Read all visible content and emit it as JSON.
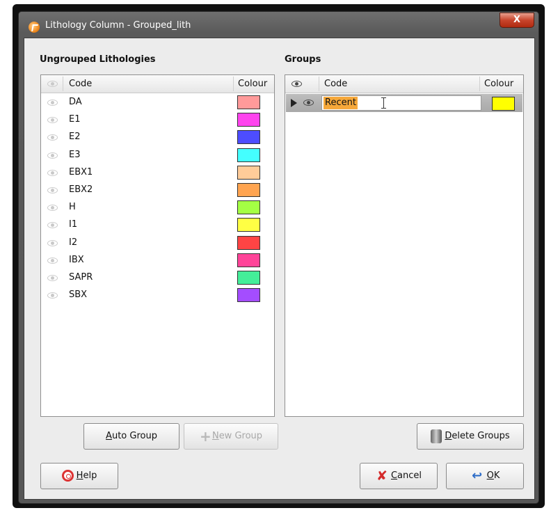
{
  "window": {
    "title": "Lithology Column - Grouped_lith",
    "close_glyph": "X"
  },
  "ungrouped": {
    "label": "Ungrouped Lithologies",
    "columns": {
      "code": "Code",
      "colour": "Colour"
    },
    "rows": [
      {
        "code": "DA",
        "colour": "#FF9A9A"
      },
      {
        "code": "E1",
        "colour": "#FF44EE"
      },
      {
        "code": "E2",
        "colour": "#4D4DFF"
      },
      {
        "code": "E3",
        "colour": "#44FFFF"
      },
      {
        "code": "EBX1",
        "colour": "#FFCC99"
      },
      {
        "code": "EBX2",
        "colour": "#FFA450"
      },
      {
        "code": "H",
        "colour": "#A4FF44"
      },
      {
        "code": "I1",
        "colour": "#FFFF44"
      },
      {
        "code": "I2",
        "colour": "#FF4444"
      },
      {
        "code": "IBX",
        "colour": "#FF4499"
      },
      {
        "code": "SAPR",
        "colour": "#44EE99"
      },
      {
        "code": "SBX",
        "colour": "#A44DFF"
      }
    ]
  },
  "groups": {
    "label": "Groups",
    "columns": {
      "code": "Code",
      "colour": "Colour"
    },
    "rows": [
      {
        "code": "Recent",
        "colour": "#FFFF00",
        "editing": true,
        "selected": true
      }
    ]
  },
  "buttons": {
    "auto_group": {
      "mnemonic": "A",
      "rest": "uto Group"
    },
    "new_group": {
      "mnemonic": "N",
      "rest": "ew Group",
      "enabled": false
    },
    "delete_groups": {
      "mnemonic": "D",
      "rest": "elete Groups"
    },
    "help": {
      "mnemonic": "H",
      "rest": "elp"
    },
    "cancel": {
      "mnemonic": "C",
      "rest": "ancel"
    },
    "ok": {
      "mnemonic": "O",
      "rest": "K"
    }
  },
  "icons": {
    "app": "app-logo-icon",
    "visibility": "eye-icon",
    "help": "lifebuoy-icon",
    "cancel": "cancel-x-icon",
    "ok": "ok-arrow-icon",
    "delete": "trash-icon",
    "new": "plus-icon"
  }
}
